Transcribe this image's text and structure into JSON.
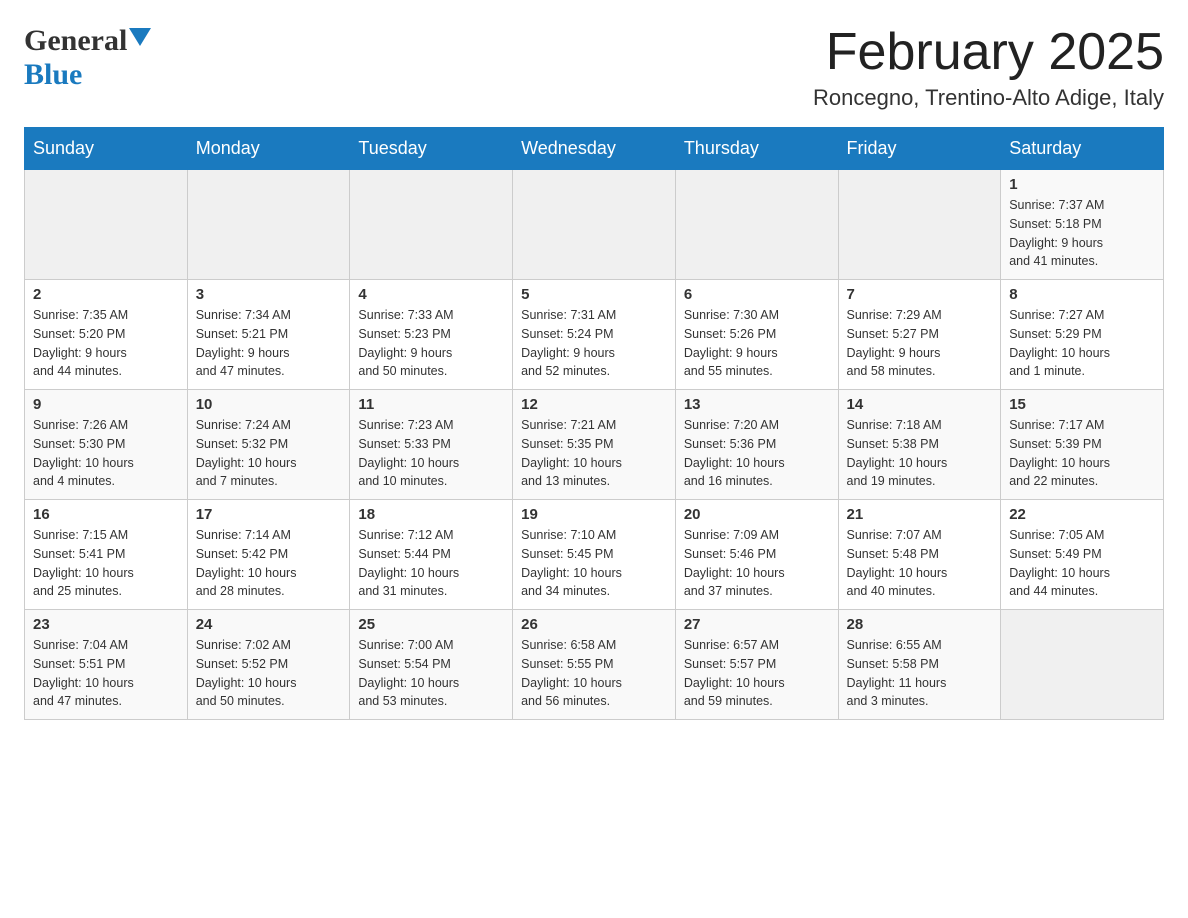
{
  "header": {
    "logo_general": "General",
    "logo_blue": "Blue",
    "month_title": "February 2025",
    "location": "Roncegno, Trentino-Alto Adige, Italy"
  },
  "days_of_week": [
    "Sunday",
    "Monday",
    "Tuesday",
    "Wednesday",
    "Thursday",
    "Friday",
    "Saturday"
  ],
  "weeks": [
    [
      {
        "day": "",
        "info": ""
      },
      {
        "day": "",
        "info": ""
      },
      {
        "day": "",
        "info": ""
      },
      {
        "day": "",
        "info": ""
      },
      {
        "day": "",
        "info": ""
      },
      {
        "day": "",
        "info": ""
      },
      {
        "day": "1",
        "info": "Sunrise: 7:37 AM\nSunset: 5:18 PM\nDaylight: 9 hours\nand 41 minutes."
      }
    ],
    [
      {
        "day": "2",
        "info": "Sunrise: 7:35 AM\nSunset: 5:20 PM\nDaylight: 9 hours\nand 44 minutes."
      },
      {
        "day": "3",
        "info": "Sunrise: 7:34 AM\nSunset: 5:21 PM\nDaylight: 9 hours\nand 47 minutes."
      },
      {
        "day": "4",
        "info": "Sunrise: 7:33 AM\nSunset: 5:23 PM\nDaylight: 9 hours\nand 50 minutes."
      },
      {
        "day": "5",
        "info": "Sunrise: 7:31 AM\nSunset: 5:24 PM\nDaylight: 9 hours\nand 52 minutes."
      },
      {
        "day": "6",
        "info": "Sunrise: 7:30 AM\nSunset: 5:26 PM\nDaylight: 9 hours\nand 55 minutes."
      },
      {
        "day": "7",
        "info": "Sunrise: 7:29 AM\nSunset: 5:27 PM\nDaylight: 9 hours\nand 58 minutes."
      },
      {
        "day": "8",
        "info": "Sunrise: 7:27 AM\nSunset: 5:29 PM\nDaylight: 10 hours\nand 1 minute."
      }
    ],
    [
      {
        "day": "9",
        "info": "Sunrise: 7:26 AM\nSunset: 5:30 PM\nDaylight: 10 hours\nand 4 minutes."
      },
      {
        "day": "10",
        "info": "Sunrise: 7:24 AM\nSunset: 5:32 PM\nDaylight: 10 hours\nand 7 minutes."
      },
      {
        "day": "11",
        "info": "Sunrise: 7:23 AM\nSunset: 5:33 PM\nDaylight: 10 hours\nand 10 minutes."
      },
      {
        "day": "12",
        "info": "Sunrise: 7:21 AM\nSunset: 5:35 PM\nDaylight: 10 hours\nand 13 minutes."
      },
      {
        "day": "13",
        "info": "Sunrise: 7:20 AM\nSunset: 5:36 PM\nDaylight: 10 hours\nand 16 minutes."
      },
      {
        "day": "14",
        "info": "Sunrise: 7:18 AM\nSunset: 5:38 PM\nDaylight: 10 hours\nand 19 minutes."
      },
      {
        "day": "15",
        "info": "Sunrise: 7:17 AM\nSunset: 5:39 PM\nDaylight: 10 hours\nand 22 minutes."
      }
    ],
    [
      {
        "day": "16",
        "info": "Sunrise: 7:15 AM\nSunset: 5:41 PM\nDaylight: 10 hours\nand 25 minutes."
      },
      {
        "day": "17",
        "info": "Sunrise: 7:14 AM\nSunset: 5:42 PM\nDaylight: 10 hours\nand 28 minutes."
      },
      {
        "day": "18",
        "info": "Sunrise: 7:12 AM\nSunset: 5:44 PM\nDaylight: 10 hours\nand 31 minutes."
      },
      {
        "day": "19",
        "info": "Sunrise: 7:10 AM\nSunset: 5:45 PM\nDaylight: 10 hours\nand 34 minutes."
      },
      {
        "day": "20",
        "info": "Sunrise: 7:09 AM\nSunset: 5:46 PM\nDaylight: 10 hours\nand 37 minutes."
      },
      {
        "day": "21",
        "info": "Sunrise: 7:07 AM\nSunset: 5:48 PM\nDaylight: 10 hours\nand 40 minutes."
      },
      {
        "day": "22",
        "info": "Sunrise: 7:05 AM\nSunset: 5:49 PM\nDaylight: 10 hours\nand 44 minutes."
      }
    ],
    [
      {
        "day": "23",
        "info": "Sunrise: 7:04 AM\nSunset: 5:51 PM\nDaylight: 10 hours\nand 47 minutes."
      },
      {
        "day": "24",
        "info": "Sunrise: 7:02 AM\nSunset: 5:52 PM\nDaylight: 10 hours\nand 50 minutes."
      },
      {
        "day": "25",
        "info": "Sunrise: 7:00 AM\nSunset: 5:54 PM\nDaylight: 10 hours\nand 53 minutes."
      },
      {
        "day": "26",
        "info": "Sunrise: 6:58 AM\nSunset: 5:55 PM\nDaylight: 10 hours\nand 56 minutes."
      },
      {
        "day": "27",
        "info": "Sunrise: 6:57 AM\nSunset: 5:57 PM\nDaylight: 10 hours\nand 59 minutes."
      },
      {
        "day": "28",
        "info": "Sunrise: 6:55 AM\nSunset: 5:58 PM\nDaylight: 11 hours\nand 3 minutes."
      },
      {
        "day": "",
        "info": ""
      }
    ]
  ]
}
